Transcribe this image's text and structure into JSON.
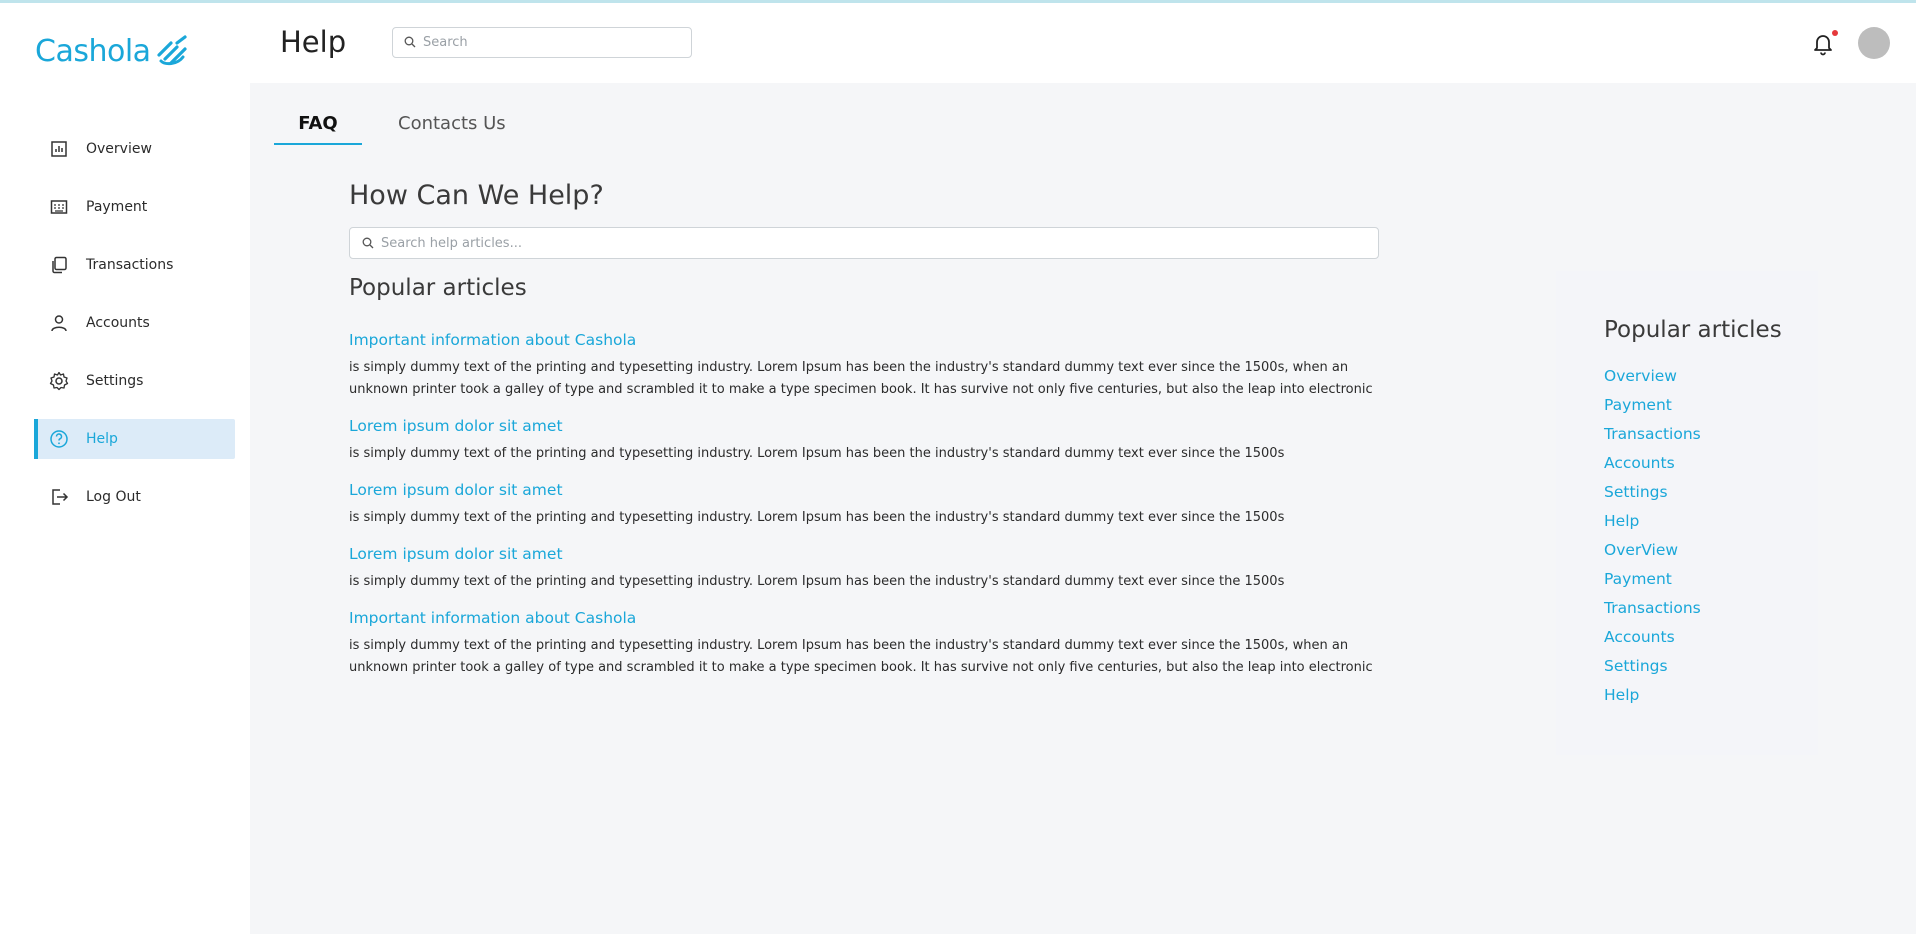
{
  "brand": {
    "name": "Cashola",
    "accent": "#1aa7d9"
  },
  "header": {
    "title": "Help",
    "search_placeholder": "Search"
  },
  "sidebar": {
    "items": [
      {
        "label": "Overview",
        "icon": "bar-chart-icon"
      },
      {
        "label": "Payment",
        "icon": "keyboard-icon"
      },
      {
        "label": "Transactions",
        "icon": "copy-icon"
      },
      {
        "label": "Accounts",
        "icon": "user-icon"
      },
      {
        "label": "Settings",
        "icon": "gear-icon"
      },
      {
        "label": "Help",
        "icon": "help-circle-icon",
        "active": true
      },
      {
        "label": "Log Out",
        "icon": "logout-icon"
      }
    ]
  },
  "tabs": [
    {
      "label": "FAQ",
      "active": true
    },
    {
      "label": "Contacts Us"
    }
  ],
  "main": {
    "heading": "How Can We Help?",
    "search_placeholder": "Search help articles...",
    "popular_heading": "Popular articles",
    "articles": [
      {
        "title": "Important information about Cashola",
        "desc": "is simply dummy text of the printing and typesetting industry. Lorem Ipsum has been the industry's standard dummy text ever since the 1500s, when an unknown printer took a galley of type and scrambled it to make a type specimen book. It has survive not only five centuries, but also the leap into electronic"
      },
      {
        "title": "Lorem ipsum dolor sit amet",
        "desc": "is simply dummy text of the printing and typesetting industry. Lorem Ipsum has been the industry's standard dummy text ever since the 1500s"
      },
      {
        "title": "Lorem ipsum dolor sit amet",
        "desc": "is simply dummy text of the printing and typesetting industry. Lorem Ipsum has been the industry's standard dummy text ever since the 1500s"
      },
      {
        "title": "Lorem ipsum dolor sit amet",
        "desc": "is simply dummy text of the printing and typesetting industry. Lorem Ipsum has been the industry's standard dummy text ever since the 1500s"
      },
      {
        "title": "Important information about Cashola",
        "desc": "is simply dummy text of the printing and typesetting industry. Lorem Ipsum has been the industry's standard dummy text ever since the 1500s, when an unknown printer took a galley of type and scrambled it to make a type specimen book. It has survive not only five centuries, but also the leap into electronic"
      }
    ]
  },
  "side_panel": {
    "heading": "Popular articles",
    "links": [
      "Overview",
      "Payment",
      "Transactions",
      "Accounts",
      "Settings",
      "Help",
      "OverView",
      "Payment",
      "Transactions",
      "Accounts",
      "Settings",
      "Help"
    ]
  }
}
